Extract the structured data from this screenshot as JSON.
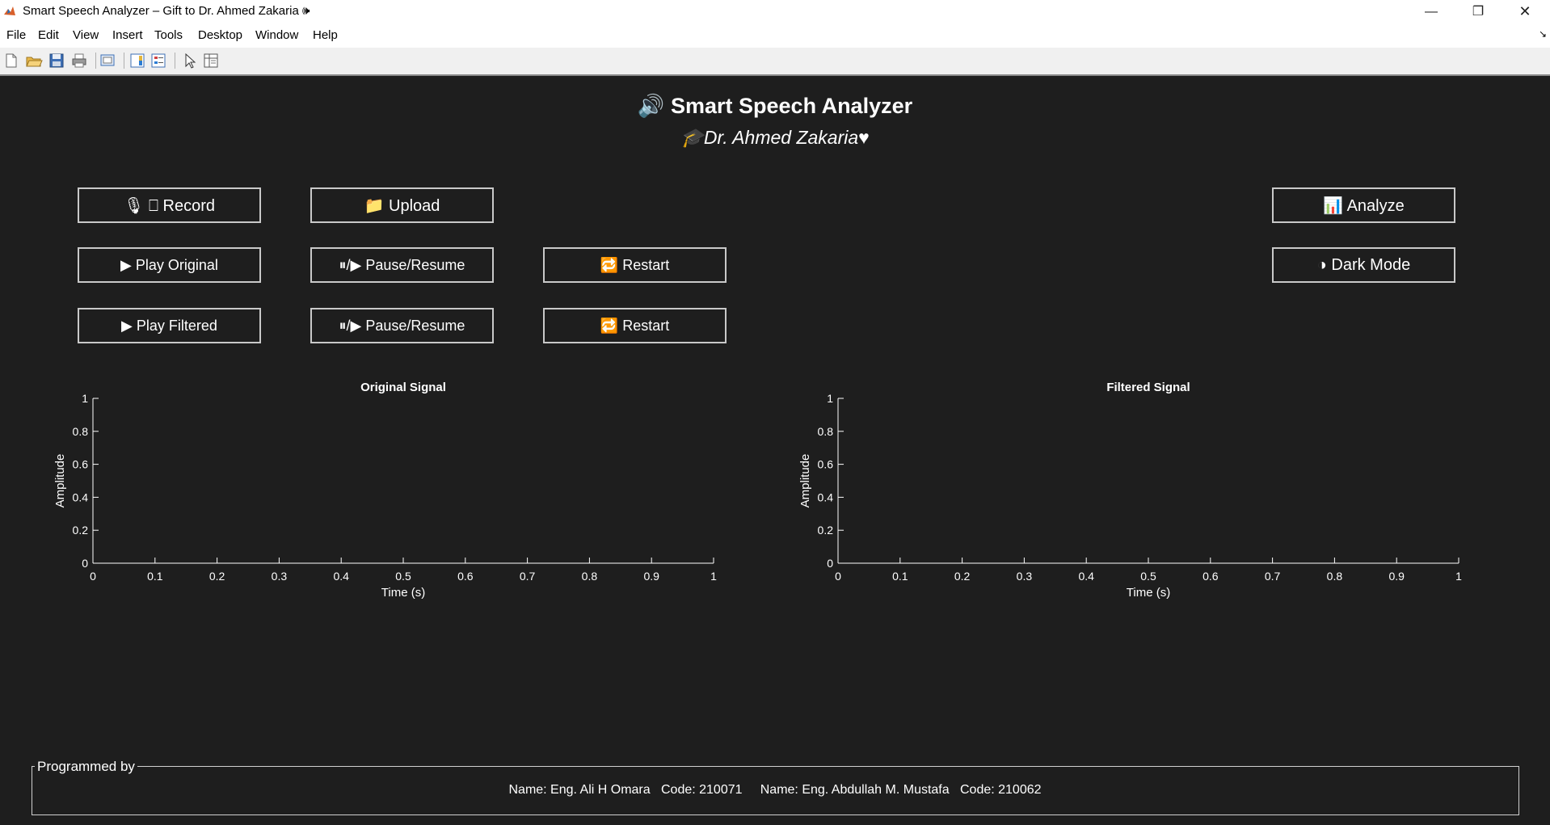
{
  "window": {
    "title": "Smart Speech Analyzer – Gift to Dr. Ahmed Zakaria 🕪",
    "minimize": "—",
    "maximize": "❐",
    "close": "✕"
  },
  "menubar": {
    "items": [
      "File",
      "Edit",
      "View",
      "Insert",
      "Tools",
      "Desktop",
      "Window",
      "Help"
    ],
    "right_icon": "↘"
  },
  "toolbar": {
    "icons": [
      "new-file-icon",
      "open-folder-icon",
      "save-icon",
      "print-icon",
      "print-preview-icon",
      "colorbar-icon",
      "legend-icon",
      "pointer-icon",
      "property-inspector-icon"
    ]
  },
  "header": {
    "title": "🔊 Smart Speech Analyzer",
    "subtitle": "🎓Dr. Ahmed Zakaria♥"
  },
  "buttons": {
    "record": "🎙 ⎕ Record",
    "upload": "📁 Upload",
    "analyze": "📊 Analyze",
    "play_original": "▶ Play Original",
    "pause_resume_original": "⏸/▶ Pause/Resume",
    "restart_original": "🔁 Restart",
    "dark_mode": "◑ Dark Mode",
    "play_filtered": "▶ Play Filtered",
    "pause_resume_filtered": "⏸/▶ Pause/Resume",
    "restart_filtered": "🔁 Restart"
  },
  "chart_data": [
    {
      "type": "line",
      "title": "Original Signal",
      "xlabel": "Time (s)",
      "ylabel": "Amplitude",
      "xlim": [
        0,
        1
      ],
      "ylim": [
        0,
        1
      ],
      "xticks": [
        "0",
        "0.1",
        "0.2",
        "0.3",
        "0.4",
        "0.5",
        "0.6",
        "0.7",
        "0.8",
        "0.9",
        "1"
      ],
      "yticks": [
        "0",
        "0.2",
        "0.4",
        "0.6",
        "0.8",
        "1"
      ],
      "grid": false,
      "series": []
    },
    {
      "type": "line",
      "title": "Filtered Signal",
      "xlabel": "Time (s)",
      "ylabel": "Amplitude",
      "xlim": [
        0,
        1
      ],
      "ylim": [
        0,
        1
      ],
      "xticks": [
        "0",
        "0.1",
        "0.2",
        "0.3",
        "0.4",
        "0.5",
        "0.6",
        "0.7",
        "0.8",
        "0.9",
        "1"
      ],
      "yticks": [
        "0",
        "0.2",
        "0.4",
        "0.6",
        "0.8",
        "1"
      ],
      "grid": false,
      "series": []
    }
  ],
  "panel": {
    "legend": "Programmed by",
    "text": "Name: Eng. Ali H Omara   Code: 210071     Name: Eng. Abdullah M. Mustafa   Code: 210062"
  },
  "colors": {
    "background": "#1e1e1e",
    "foreground": "#ffffff",
    "button_border": "#c9c9c9"
  }
}
